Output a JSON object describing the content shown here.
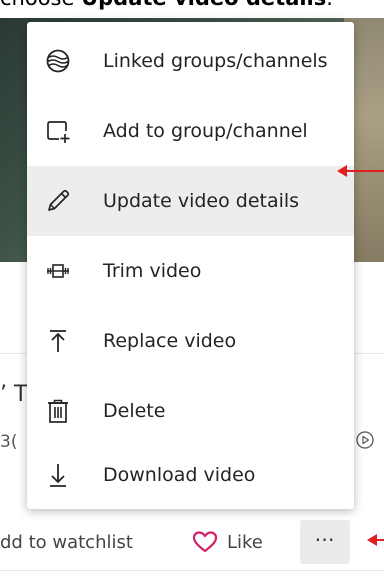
{
  "instruction": {
    "prefix": "choose ",
    "bold": "Update video details",
    "suffix": "."
  },
  "background": {
    "title_fragment": "’ T",
    "sub_fragment": "3(",
    "watchlist_label": "dd to watchlist",
    "like_label": "Like",
    "more_label": "⋯"
  },
  "menu": {
    "items": [
      {
        "label": "Linked groups/channels",
        "icon": "linked-groups-icon"
      },
      {
        "label": "Add to group/channel",
        "icon": "add-to-group-icon"
      },
      {
        "label": "Update video details",
        "icon": "pencil-icon",
        "highlighted": true
      },
      {
        "label": "Trim video",
        "icon": "trim-icon"
      },
      {
        "label": "Replace video",
        "icon": "replace-upload-icon"
      },
      {
        "label": "Delete",
        "icon": "trash-icon"
      },
      {
        "label": "Download video",
        "icon": "download-icon"
      }
    ]
  },
  "colors": {
    "annotation_arrow": "#e02020",
    "heart": "#d0216a",
    "menu_highlight": "#ededed"
  }
}
